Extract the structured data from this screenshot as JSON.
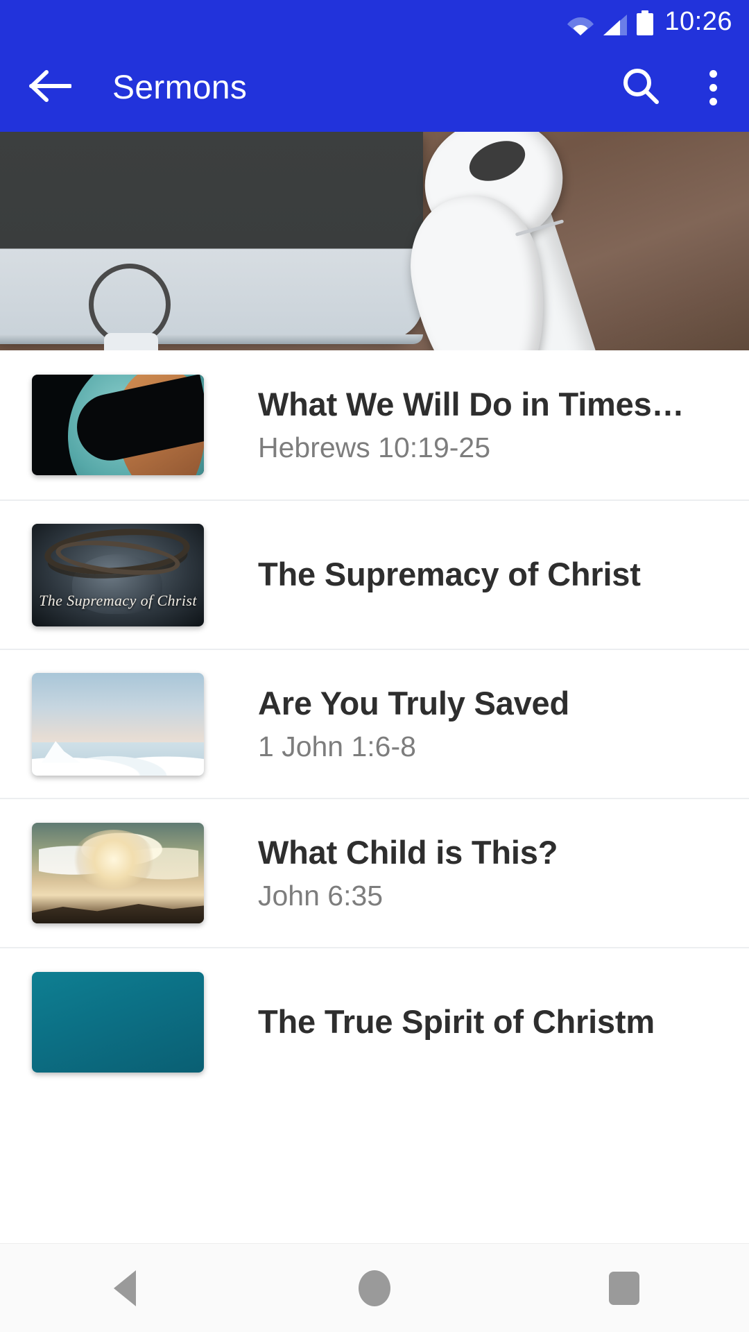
{
  "statusbar": {
    "time": "10:26",
    "icons": [
      "wifi-icon",
      "cell-signal-icon",
      "battery-icon"
    ]
  },
  "appbar": {
    "back_icon": "back-arrow-icon",
    "title": "Sermons",
    "search_icon": "search-icon",
    "overflow_icon": "overflow-menu-icon",
    "background_color": "#2233db",
    "text_color": "#ffffff"
  },
  "hero": {
    "name": "hero-banner-image",
    "description": "smartphone with white earbuds on wooden surface"
  },
  "list": {
    "items": [
      {
        "title": "What We Will Do in Times…",
        "subtitle": "Hebrews 10:19-25",
        "thumb": "globe-thumbnail"
      },
      {
        "title": "The Supremacy of Christ",
        "subtitle": "",
        "thumb": "crown-of-thorns-thumbnail",
        "thumb_caption": "The Supremacy of Christ"
      },
      {
        "title": "Are You Truly Saved",
        "subtitle": "1 John 1:6-8",
        "thumb": "sky-clouds-thumbnail"
      },
      {
        "title": "What Child is This?",
        "subtitle": "John 6:35",
        "thumb": "sunbeam-clouds-thumbnail"
      },
      {
        "title": "The True Spirit of Christm",
        "subtitle": "",
        "thumb": "teal-thumbnail"
      }
    ]
  },
  "navbar": {
    "back_label": "back-triangle-icon",
    "home_label": "home-circle-icon",
    "recents_label": "recents-square-icon"
  }
}
